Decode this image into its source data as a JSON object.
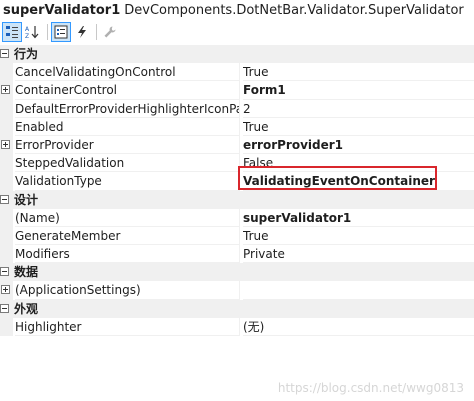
{
  "header": {
    "object_name": "superValidator1",
    "object_type": "DevComponents.DotNetBar.Validator.SuperValidator"
  },
  "toolbar": {
    "buttons": [
      {
        "icon": "categorized-icon",
        "active": true
      },
      {
        "icon": "alphabetical-icon",
        "active": false
      },
      {
        "icon": "properties-icon",
        "active": true
      },
      {
        "icon": "events-lightning-icon",
        "active": false
      },
      {
        "icon": "property-pages-wrench-icon",
        "active": false
      }
    ]
  },
  "grid": {
    "categories": [
      {
        "label": "行为",
        "properties": [
          {
            "name": "CancelValidatingOnControl",
            "value": "True",
            "bold": false,
            "expandable": false
          },
          {
            "name": "ContainerControl",
            "value": "Form1",
            "bold": true,
            "expandable": true
          },
          {
            "name": "DefaultErrorProviderHighlighterIconPa",
            "value": "2",
            "bold": false,
            "expandable": false
          },
          {
            "name": "Enabled",
            "value": "True",
            "bold": false,
            "expandable": false
          },
          {
            "name": "ErrorProvider",
            "value": "errorProvider1",
            "bold": true,
            "expandable": true
          },
          {
            "name": "SteppedValidation",
            "value": "False",
            "bold": false,
            "expandable": false
          },
          {
            "name": "ValidationType",
            "value": "ValidatingEventOnContainer",
            "bold": true,
            "expandable": false
          }
        ]
      },
      {
        "label": "设计",
        "properties": [
          {
            "name": "(Name)",
            "value": "superValidator1",
            "bold": true,
            "expandable": false
          },
          {
            "name": "GenerateMember",
            "value": "True",
            "bold": false,
            "expandable": false
          },
          {
            "name": "Modifiers",
            "value": "Private",
            "bold": false,
            "expandable": false
          }
        ]
      },
      {
        "label": "数据",
        "properties": [
          {
            "name": "(ApplicationSettings)",
            "value": "",
            "bold": false,
            "expandable": true
          }
        ]
      },
      {
        "label": "外观",
        "properties": [
          {
            "name": "Highlighter",
            "value": "(无)",
            "bold": false,
            "expandable": false
          }
        ]
      }
    ]
  },
  "watermark": "https://blog.csdn.net/wwg0813",
  "colors": {
    "highlight_box": "#d9262c",
    "category_bg": "#f0f0f0",
    "active_button_border": "#3399ff"
  }
}
